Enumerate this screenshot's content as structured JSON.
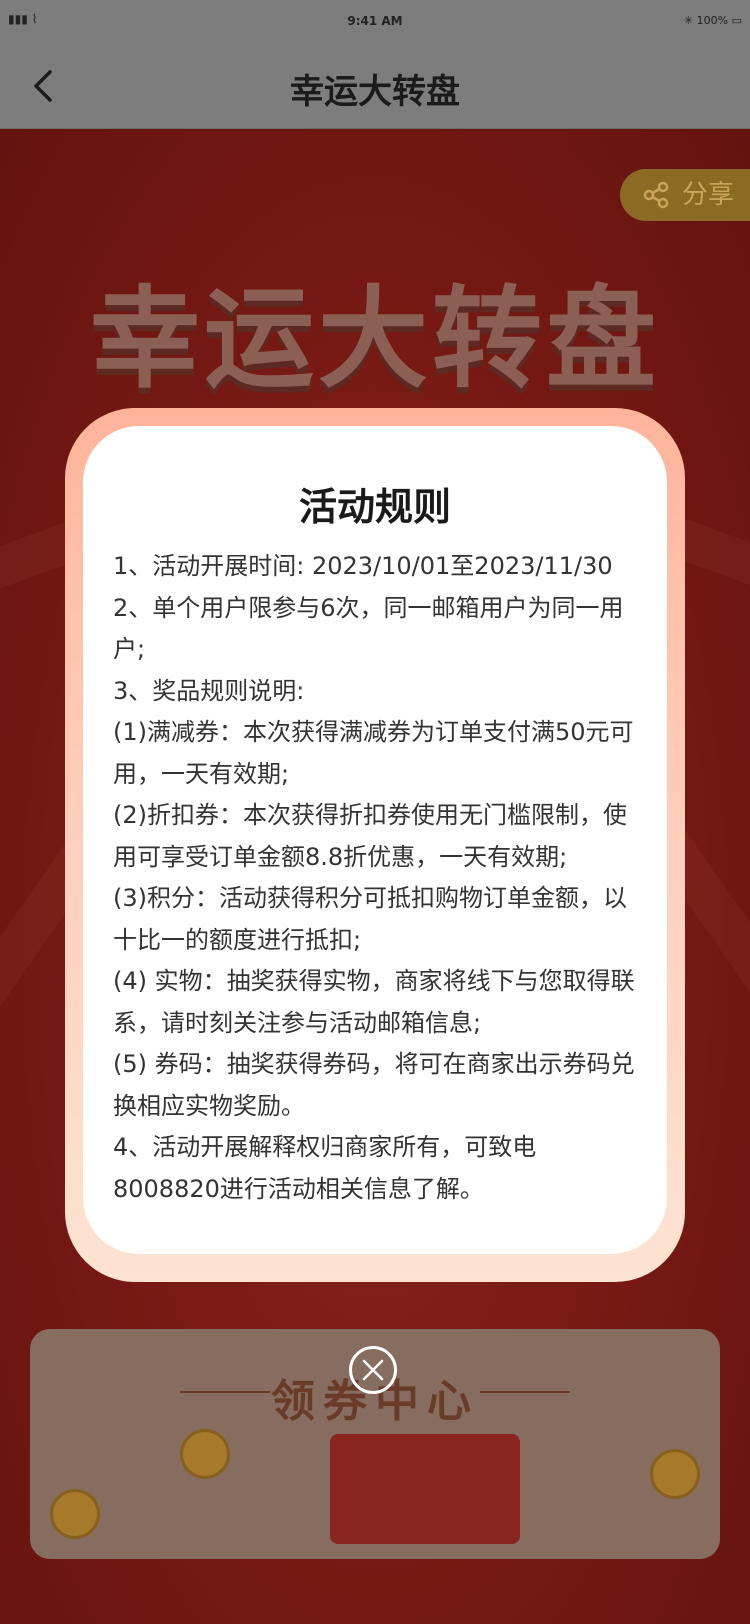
{
  "status_bar": {
    "time": "9:41 AM",
    "signal": "▮▮▮ ⌇",
    "battery": "✳ 100% ▭"
  },
  "nav": {
    "title": "幸运大转盘"
  },
  "background": {
    "big_title": "幸运大转盘",
    "share_label": "分享",
    "coupon_center_title": "领券中心"
  },
  "modal": {
    "title": "活动规则",
    "rules": [
      "1、活动开展时间: 2023/10/01至2023/11/30",
      "2、单个用户限参与6次，同一邮箱用户为同一用户;",
      "3、奖品规则说明:",
      "(1)满减券：本次获得满减券为订单支付满50元可用，一天有效期;",
      "(2)折扣券：本次获得折扣券使用无门槛限制，使用可享受订单金额8.8折优惠，一天有效期;",
      "(3)积分：活动获得积分可抵扣购物订单金额，以十比一的额度进行抵扣;",
      "(4) 实物：抽奖获得实物，商家将线下与您取得联系，请时刻关注参与活动邮箱信息;",
      "(5) 券码：抽奖获得券码，将可在商家出示券码兑换相应实物奖励。",
      "4、活动开展解释权归商家所有，可致电8008820进行活动相关信息了解。"
    ]
  },
  "icons": {
    "back": "chevron-left-icon",
    "share": "share-icon",
    "close": "close-icon"
  }
}
